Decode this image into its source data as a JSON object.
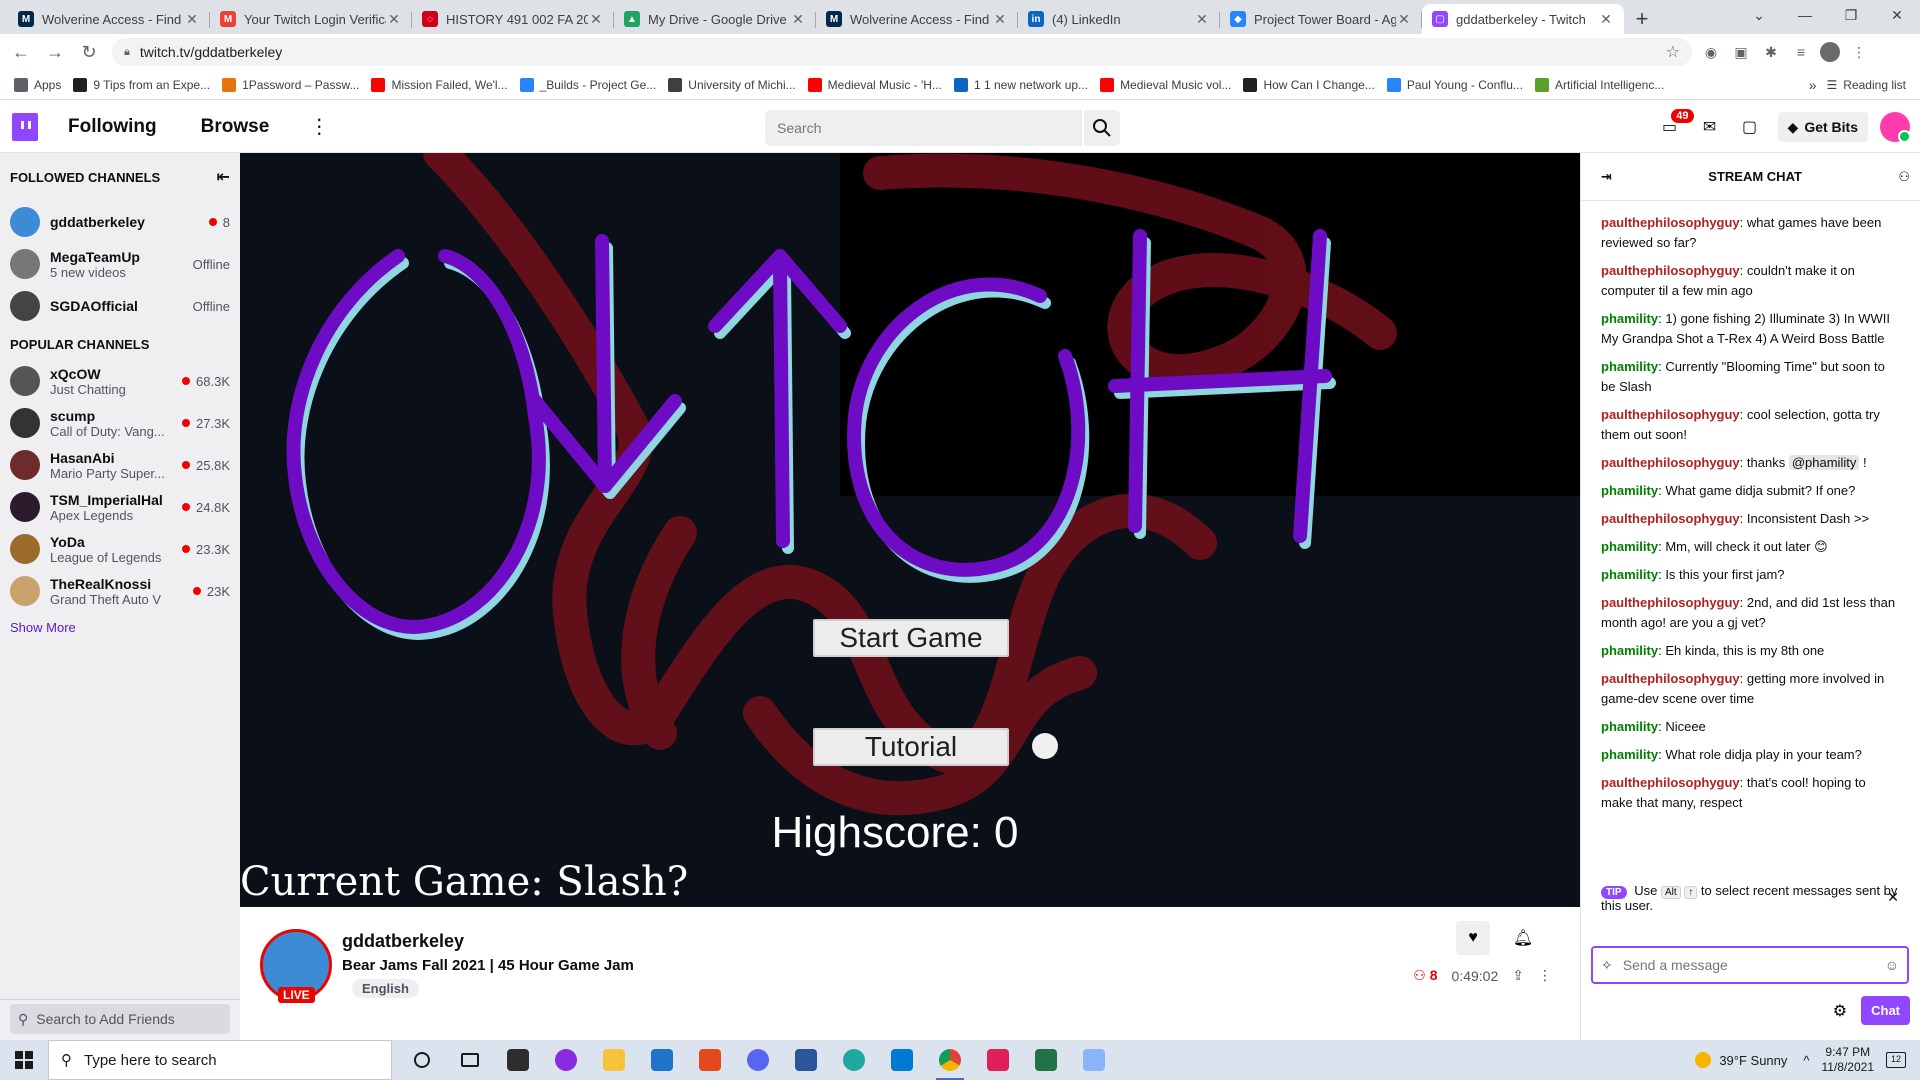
{
  "browser": {
    "tabs": [
      {
        "title": "Wolverine Access - Find &",
        "color": "#00274c",
        "letter": "M"
      },
      {
        "title": "Your Twitch Login Verificati",
        "color": "#ea4335",
        "letter": "M"
      },
      {
        "title": "HISTORY 491 002 FA 2021",
        "color": "#d0021b",
        "letter": "◌"
      },
      {
        "title": "My Drive - Google Drive",
        "color": "#1fa463",
        "letter": "▲"
      },
      {
        "title": "Wolverine Access - Find &",
        "color": "#00274c",
        "letter": "M"
      },
      {
        "title": "(4) LinkedIn",
        "color": "#0a66c2",
        "letter": "in"
      },
      {
        "title": "Project Tower Board - Agil",
        "color": "#2684ff",
        "letter": "◆"
      },
      {
        "title": "gddatberkeley - Twitch",
        "color": "#9147ff",
        "letter": "▢"
      }
    ],
    "url": "twitch.tv/gddatberkeley",
    "bookmarks": [
      {
        "label": "Apps",
        "color": "#5f6368"
      },
      {
        "label": "9 Tips from an Expe...",
        "color": "#202124"
      },
      {
        "label": "1Password – Passw...",
        "color": "#e8730c"
      },
      {
        "label": "Mission Failed, We'l...",
        "color": "#ff0000"
      },
      {
        "label": "_Builds - Project Ge...",
        "color": "#2684ff"
      },
      {
        "label": "University of Michi...",
        "color": "#3c4043"
      },
      {
        "label": "Medieval Music - 'H...",
        "color": "#ff0000"
      },
      {
        "label": "1 1 new network up...",
        "color": "#0a66c2"
      },
      {
        "label": "Medieval Music vol...",
        "color": "#ff0000"
      },
      {
        "label": "How Can I Change...",
        "color": "#202124"
      },
      {
        "label": "Paul Young - Conflu...",
        "color": "#2684ff"
      },
      {
        "label": "Artificial Intelligenc...",
        "color": "#5aa02c"
      }
    ],
    "reading_list": "Reading list"
  },
  "twitch": {
    "nav": {
      "following": "Following",
      "browse": "Browse",
      "search_placeholder": "Search",
      "notif_count": "49",
      "get_bits": "Get Bits"
    },
    "sidebar": {
      "followed_title": "FOLLOWED CHANNELS",
      "followed": [
        {
          "name": "gddatberkeley",
          "sub": "",
          "viewers": "8",
          "live": true,
          "color": "#3d8bd4"
        },
        {
          "name": "MegaTeamUp",
          "sub": "5 new videos",
          "viewers": "Offline",
          "live": false,
          "color": "#777"
        },
        {
          "name": "SGDAOfficial",
          "sub": "",
          "viewers": "Offline",
          "live": false,
          "color": "#444"
        }
      ],
      "popular_title": "POPULAR CHANNELS",
      "popular": [
        {
          "name": "xQcOW",
          "sub": "Just Chatting",
          "viewers": "68.3K",
          "color": "#555"
        },
        {
          "name": "scump",
          "sub": "Call of Duty: Vang...",
          "viewers": "27.3K",
          "color": "#333"
        },
        {
          "name": "HasanAbi",
          "sub": "Mario Party Super...",
          "viewers": "25.8K",
          "color": "#6d2b2b"
        },
        {
          "name": "TSM_ImperialHal",
          "sub": "Apex Legends",
          "viewers": "24.8K",
          "color": "#2b1b2b"
        },
        {
          "name": "YoDa",
          "sub": "League of Legends",
          "viewers": "23.3K",
          "color": "#9a6b2a"
        },
        {
          "name": "TheRealKnossi",
          "sub": "Grand Theft Auto V",
          "viewers": "23K",
          "color": "#c9a36b"
        }
      ],
      "show_more": "Show More",
      "friends_placeholder": "Search to Add Friends"
    },
    "game": {
      "start": "Start Game",
      "tutorial": "Tutorial",
      "highscore": "Highscore: 0",
      "current_game": "Current Game: Slash?"
    },
    "channel": {
      "name": "gddatberkeley",
      "title": "Bear Jams Fall 2021 | 45 Hour Game Jam",
      "tag": "English",
      "live": "LIVE",
      "viewers": "8",
      "uptime": "0:49:02"
    },
    "chat": {
      "title": "STREAM CHAT",
      "messages": [
        {
          "user": "paulthephilosophyguy",
          "text": "what games have been reviewed so far?",
          "color": "#b22222"
        },
        {
          "user": "paulthephilosophyguy",
          "text": "couldn't make it on computer til a few min ago",
          "color": "#b22222"
        },
        {
          "user": "phamility",
          "text": "1) gone fishing 2) Illuminate 3) In WWII My Grandpa Shot a T-Rex 4) A Weird Boss Battle",
          "color": "#008000"
        },
        {
          "user": "phamility",
          "text": "Currently \"Blooming Time\" but soon to be Slash",
          "color": "#008000"
        },
        {
          "user": "paulthephilosophyguy",
          "text": "cool selection, gotta try them out soon!",
          "color": "#b22222"
        },
        {
          "user": "paulthephilosophyguy",
          "text": "thanks",
          "mention": "@phamility",
          "after": " !",
          "color": "#b22222"
        },
        {
          "user": "phamility",
          "text": "What game didja submit? If one?",
          "color": "#008000"
        },
        {
          "user": "paulthephilosophyguy",
          "text": "Inconsistent Dash >>",
          "color": "#b22222"
        },
        {
          "user": "phamility",
          "text": "Mm, will check it out later 😊",
          "color": "#008000"
        },
        {
          "user": "phamility",
          "text": "Is this your first jam?",
          "color": "#008000"
        },
        {
          "user": "paulthephilosophyguy",
          "text": "2nd, and did 1st less than month ago! are you a gj vet?",
          "color": "#b22222"
        },
        {
          "user": "phamility",
          "text": "Eh kinda, this is my 8th one",
          "color": "#008000"
        },
        {
          "user": "paulthephilosophyguy",
          "text": "getting more involved in game-dev scene over time",
          "color": "#b22222"
        },
        {
          "user": "phamility",
          "text": "Niceee",
          "color": "#008000"
        },
        {
          "user": "phamility",
          "text": "What role didja play in your team?",
          "color": "#008000"
        },
        {
          "user": "paulthephilosophyguy",
          "text": "that's cool! hoping to make that many, respect",
          "color": "#b22222"
        }
      ],
      "tip_badge": "TIP",
      "tip_use": "Use",
      "tip_key1": "Alt",
      "tip_key2": "↑",
      "tip_rest": "to select recent messages sent by this user.",
      "input_placeholder": "Send a message",
      "chat_button": "Chat"
    }
  },
  "taskbar": {
    "search_placeholder": "Type here to search",
    "weather": "39°F  Sunny",
    "time": "9:47 PM",
    "date": "11/8/2021",
    "notifications": "12"
  }
}
